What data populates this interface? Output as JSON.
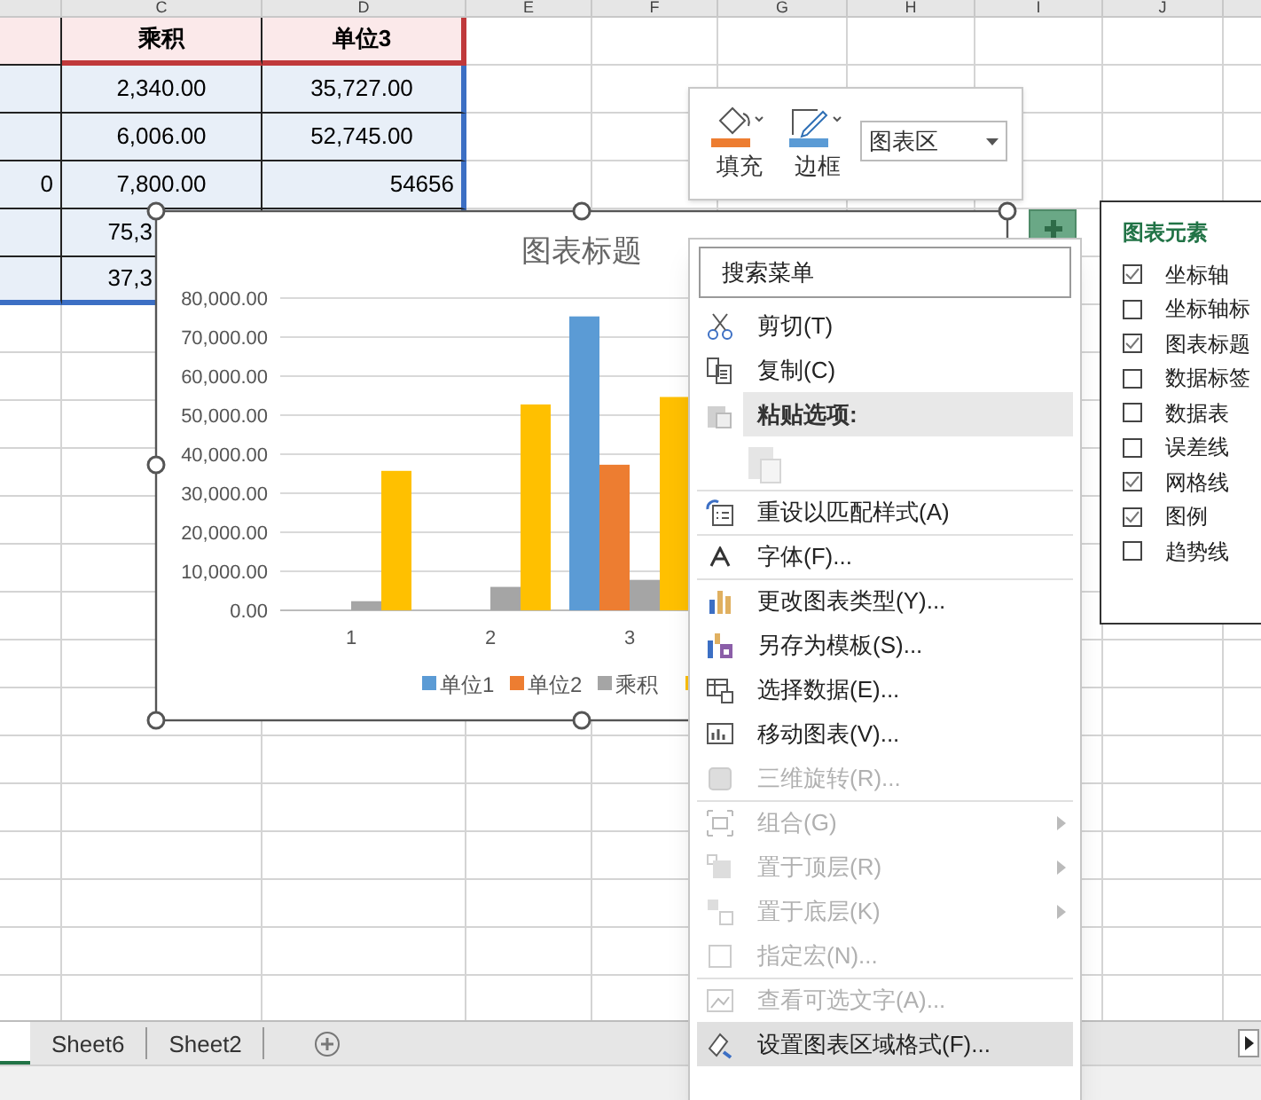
{
  "column_headers": [
    "C",
    "D",
    "E",
    "F",
    "G",
    "H",
    "I",
    "J"
  ],
  "table": {
    "header": [
      "乘积",
      "单位3"
    ],
    "rows": [
      [
        "",
        "2,340.00",
        "35,727.00"
      ],
      [
        "",
        "6,006.00",
        "52,745.00"
      ],
      [
        "0",
        "7,800.00",
        "54656"
      ],
      [
        "",
        "75,3",
        ""
      ],
      [
        "",
        "37,3",
        ""
      ]
    ]
  },
  "chart": {
    "chart_data": {
      "type": "bar",
      "title": "图表标题",
      "categories": [
        "1",
        "2",
        "3"
      ],
      "ylim": [
        0,
        80000
      ],
      "grid": true,
      "legend": true,
      "yticks": [
        {
          "value": 0,
          "label": "0.00"
        },
        {
          "value": 10000,
          "label": "10,000.00"
        },
        {
          "value": 20000,
          "label": "20,000.00"
        },
        {
          "value": 30000,
          "label": "30,000.00"
        },
        {
          "value": 40000,
          "label": "40,000.00"
        },
        {
          "value": 50000,
          "label": "50,000.00"
        },
        {
          "value": 60000,
          "label": "60,000.00"
        },
        {
          "value": 70000,
          "label": "70,000.00"
        },
        {
          "value": 80000,
          "label": "80,000.00"
        }
      ],
      "series": [
        {
          "name": "单位1",
          "color": "#5b9bd5",
          "values": [
            0,
            0,
            75300
          ]
        },
        {
          "name": "单位2",
          "color": "#ed7d31",
          "values": [
            0,
            0,
            37300
          ]
        },
        {
          "name": "乘积",
          "color": "#a5a5a5",
          "values": [
            2340,
            6006,
            7800
          ]
        },
        {
          "color": "#ffc000",
          "values": [
            35727,
            52745,
            54656
          ]
        }
      ]
    }
  },
  "mini_toolbar": {
    "fill_label": "填充",
    "border_label": "边框",
    "element_dropdown": "图表区"
  },
  "chart_elements": {
    "title": "图表元素",
    "items": [
      {
        "label": "坐标轴",
        "checked": true
      },
      {
        "label": "坐标轴标",
        "checked": false
      },
      {
        "label": "图表标题",
        "checked": true
      },
      {
        "label": "数据标签",
        "checked": false
      },
      {
        "label": "数据表",
        "checked": false
      },
      {
        "label": "误差线",
        "checked": false
      },
      {
        "label": "网格线",
        "checked": true
      },
      {
        "label": "图例",
        "checked": true
      },
      {
        "label": "趋势线",
        "checked": false
      }
    ]
  },
  "context_menu": {
    "search_placeholder": "搜索菜单",
    "items": [
      {
        "kind": "item",
        "label": "剪切(T)",
        "disabled": false,
        "submenu": false,
        "selected": false,
        "divider_above": false
      },
      {
        "kind": "item",
        "label": "复制(C)",
        "disabled": false,
        "submenu": false,
        "selected": false,
        "divider_above": false
      },
      {
        "kind": "heading",
        "label": "粘贴选项:"
      },
      {
        "kind": "paste",
        "disabled": true
      },
      {
        "kind": "item",
        "label": "重设以匹配样式(A)",
        "disabled": false,
        "submenu": false,
        "selected": false,
        "divider_above": true
      },
      {
        "kind": "item",
        "label": "字体(F)...",
        "disabled": false,
        "submenu": false,
        "selected": false,
        "divider_above": true
      },
      {
        "kind": "item",
        "label": "更改图表类型(Y)...",
        "disabled": false,
        "submenu": false,
        "selected": false,
        "divider_above": true
      },
      {
        "kind": "item",
        "label": "另存为模板(S)...",
        "disabled": false,
        "submenu": false,
        "selected": false,
        "divider_above": false
      },
      {
        "kind": "item",
        "label": "选择数据(E)...",
        "disabled": false,
        "submenu": false,
        "selected": false,
        "divider_above": false
      },
      {
        "kind": "item",
        "label": "移动图表(V)...",
        "disabled": false,
        "submenu": false,
        "selected": false,
        "divider_above": false
      },
      {
        "kind": "item",
        "label": "三维旋转(R)...",
        "disabled": true,
        "submenu": false,
        "selected": false,
        "divider_above": false
      },
      {
        "kind": "item",
        "label": "组合(G)",
        "disabled": true,
        "submenu": true,
        "selected": false,
        "divider_above": true
      },
      {
        "kind": "item",
        "label": "置于顶层(R)",
        "disabled": true,
        "submenu": true,
        "selected": false,
        "divider_above": false
      },
      {
        "kind": "item",
        "label": "置于底层(K)",
        "disabled": true,
        "submenu": true,
        "selected": false,
        "divider_above": false
      },
      {
        "kind": "item",
        "label": "指定宏(N)...",
        "disabled": true,
        "submenu": false,
        "selected": false,
        "divider_above": false
      },
      {
        "kind": "item",
        "label": "查看可选文字(A)...",
        "disabled": true,
        "submenu": false,
        "selected": false,
        "divider_above": true
      },
      {
        "kind": "item",
        "label": "设置图表区域格式(F)...",
        "disabled": false,
        "submenu": false,
        "selected": true,
        "divider_above": false
      }
    ]
  },
  "sheet_tabs": [
    {
      "selected": true
    },
    {
      "label": "Sheet6",
      "selected": false
    },
    {
      "label": "Sheet2",
      "selected": false
    }
  ]
}
